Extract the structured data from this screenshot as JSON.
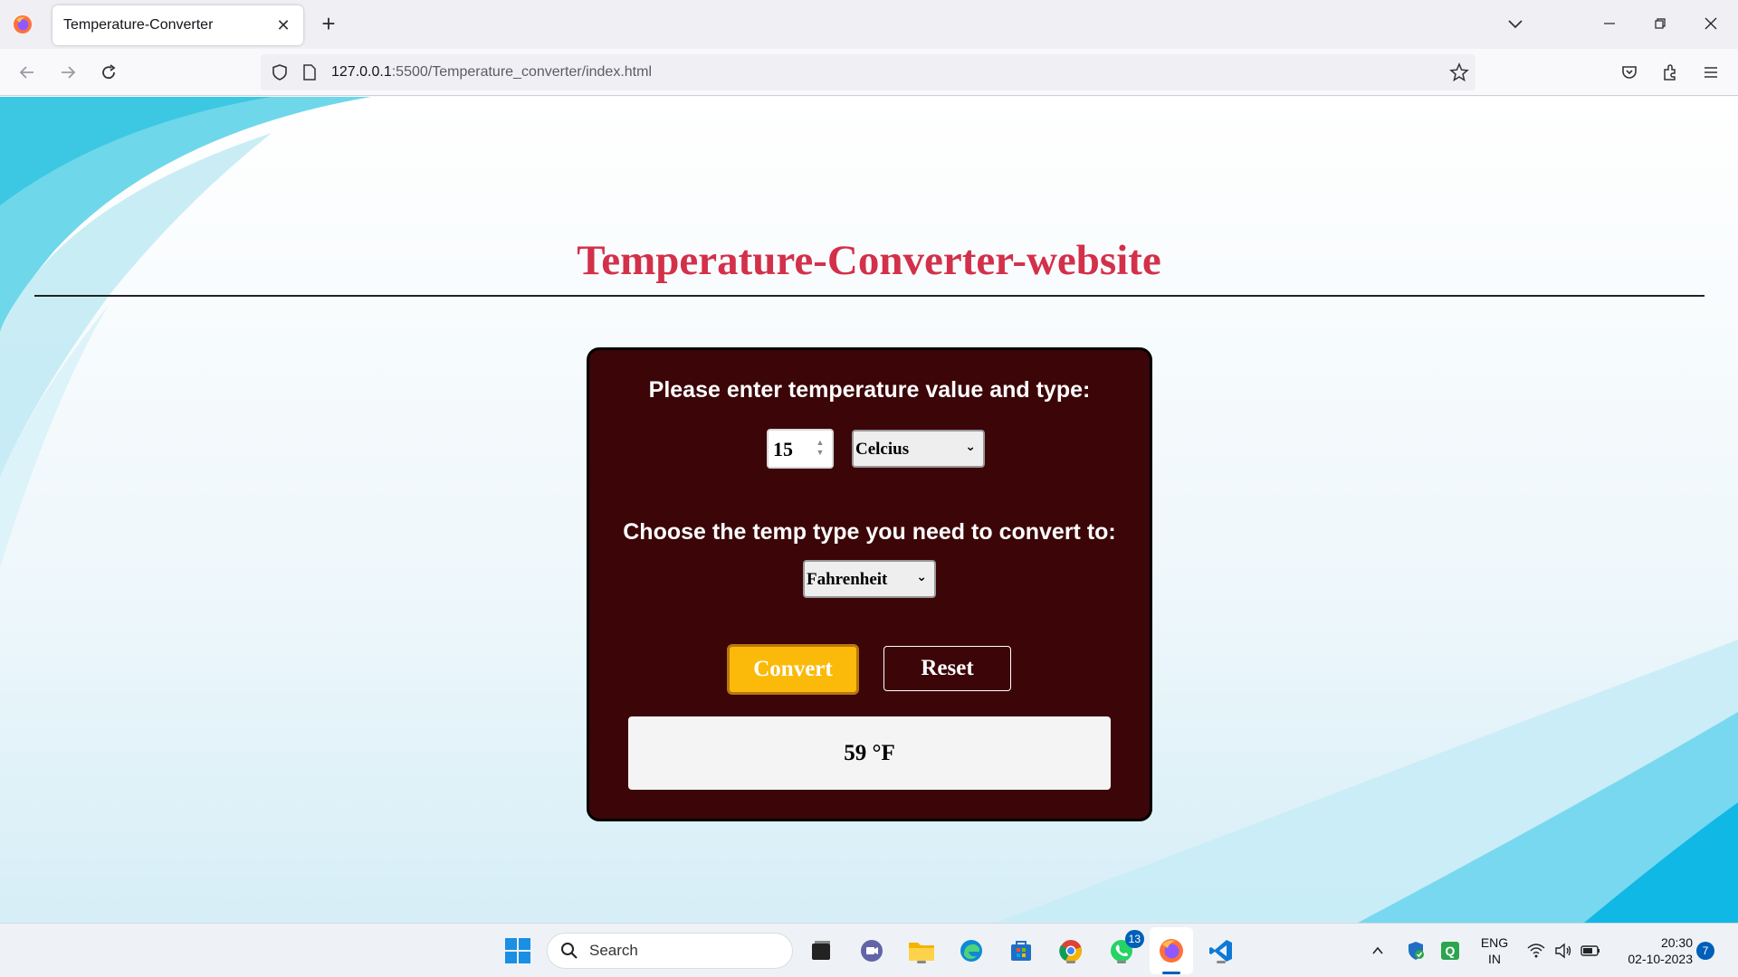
{
  "browser": {
    "tab_title": "Temperature-Converter",
    "url_host": "127.0.0.1",
    "url_rest": ":5500/Temperature_converter/index.html"
  },
  "page": {
    "title": "Temperature-Converter-website",
    "prompt_input": "Please enter temperature value and type:",
    "temperature_value": "15",
    "from_unit": "Celcius",
    "prompt_target": "Choose the temp type you need to convert to:",
    "to_unit": "Fahrenheit",
    "convert_label": "Convert",
    "reset_label": "Reset",
    "result": "59 °F"
  },
  "taskbar": {
    "search_label": "Search",
    "whatsapp_badge": "13",
    "lang_line1": "ENG",
    "lang_line2": "IN",
    "time": "20:30",
    "date": "02-10-2023",
    "notification_count": "7"
  },
  "colors": {
    "title": "#d3304a",
    "card_bg": "#3c0508",
    "convert_bg": "#fbba0a",
    "accent": "#005fb8"
  }
}
